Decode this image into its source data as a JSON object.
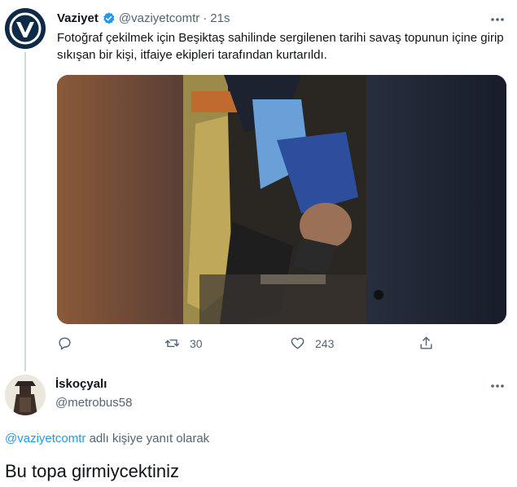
{
  "tweet": {
    "author_name": "Vaziyet",
    "author_handle": "@vaziyetcomtr",
    "separator": "·",
    "time": "21s",
    "text": "Fotoğraf çekilmek için Beşiktaş sahilinde sergilenen tarihi savaş topunun içine girip sıkışan bir kişi, itfaiye ekipleri tarafından kurtarıldı.",
    "actions": {
      "retweets": "30",
      "likes": "243"
    },
    "icons": [
      "verified-badge-icon",
      "more-icon",
      "reply-icon",
      "retweet-icon",
      "like-icon",
      "share-icon"
    ]
  },
  "reply": {
    "author_name": "İskoçyalı",
    "author_handle": "@metrobus58",
    "reply_to_mention": "@vaziyetcomtr",
    "reply_to_suffix": " adlı kişiye yanıt olarak",
    "text": "Bu topa girmiycektiniz"
  },
  "colors": {
    "accent": "#1d9bf0",
    "text": "#0f1419",
    "secondary": "#536471"
  }
}
